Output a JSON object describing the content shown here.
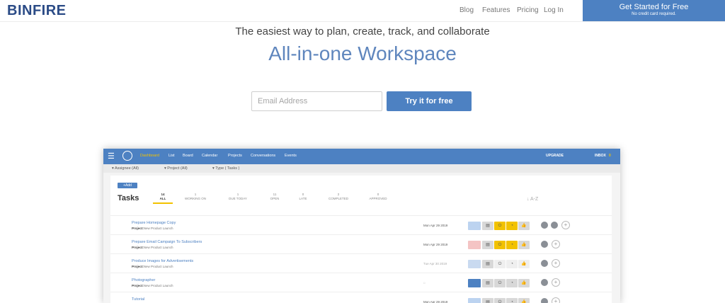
{
  "brand": {
    "logo": "BINFIRE"
  },
  "nav": {
    "items": [
      "Blog",
      "Features",
      "Pricing",
      "Log In"
    ],
    "cta_label": "Get Started for Free",
    "cta_sub": "No credit card required."
  },
  "hero": {
    "tagline": "The easiest way to plan, create, track, and collaborate",
    "headline": "All-in-one Workspace",
    "email_placeholder": "Email Address",
    "try_label": "Try it for free"
  },
  "app": {
    "nav": [
      "Dashboard",
      "List",
      "Board",
      "Calendar",
      "Projects",
      "Conversations",
      "Events"
    ],
    "upgrade": "UPGRADE",
    "inbox": "INBOX",
    "inbox_count": "0",
    "filters": [
      "Assignee (All)",
      "Project (All)",
      "Type ( Tasks )"
    ],
    "add_label": "+Add",
    "tasks_title": "Tasks",
    "tabs": [
      {
        "count": "14",
        "label": "ALL"
      },
      {
        "count": "1",
        "label": "WORKING ON"
      },
      {
        "count": "1",
        "label": "DUE TODAY"
      },
      {
        "count": "11",
        "label": "OPEN"
      },
      {
        "count": "0",
        "label": "LATE"
      },
      {
        "count": "2",
        "label": "COMPLETED"
      },
      {
        "count": "0",
        "label": "APPROVED"
      }
    ],
    "sort_label": "↓ A-Z",
    "project_prefix": "Project:",
    "tasks": [
      {
        "title": "Prepare Homepage Copy",
        "project": "New Product Launch",
        "date": "Mon Apr 29 2019",
        "status_color": "#bcd3f0",
        "btn_colors": [
          "#bcd3f0",
          "#d8d8d8",
          "#f2c200",
          "#f2c200",
          "#d8d8d8"
        ],
        "avatars": 2
      },
      {
        "title": "Prepare Email Campaign To Subscribers",
        "project": "New Product Launch",
        "date": "Mon Apr 29 2019",
        "status_color": "#f4c4c4",
        "btn_colors": [
          "#f4c4c4",
          "#d8d8d8",
          "#f2c200",
          "#f2c200",
          "#d8d8d8"
        ],
        "avatars": 1
      },
      {
        "title": "Produce Images for Advertisements",
        "project": "New Product Launch",
        "date": "Tue Apr 30 2019",
        "status_color": "#c9daf0",
        "btn_colors": [
          "#c9daf0",
          "#d8d8d8",
          "#efefef",
          "#efefef",
          "#efefef"
        ],
        "avatars": 1
      },
      {
        "title": "Photographer",
        "project": "New Product Launch",
        "date": "",
        "status_color": "#4d81c2",
        "btn_colors": [
          "#4d81c2",
          "#d8d8d8",
          "#d8d8d8",
          "#d8d8d8",
          "#d8d8d8"
        ],
        "avatars": 1
      },
      {
        "title": "Tutorial",
        "project": "",
        "date": "Mon Apr 29 2019",
        "status_color": "#bcd3f0",
        "btn_colors": [
          "#bcd3f0",
          "#d8d8d8",
          "#d8d8d8",
          "#d8d8d8",
          "#d8d8d8"
        ],
        "avatars": 1
      }
    ]
  }
}
